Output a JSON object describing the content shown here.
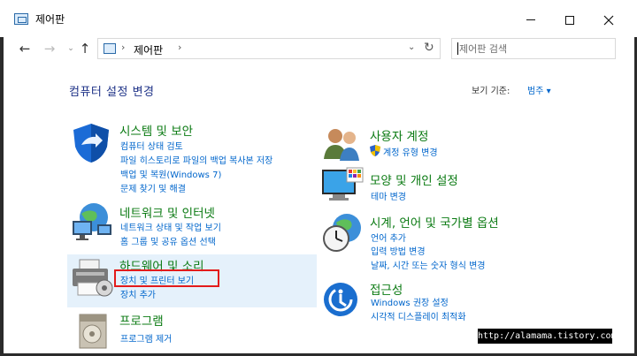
{
  "window": {
    "title": "제어판"
  },
  "nav": {
    "back": "←",
    "forward": "→",
    "recent": "⌄",
    "up": "↑",
    "address": "제어판",
    "refresh": "↻",
    "search_placeholder": "제어판 검색"
  },
  "main": {
    "heading": "컴퓨터 설정 변경",
    "viewby_label": "보기 기준:",
    "viewby_value": "범주 ▾"
  },
  "categories": [
    {
      "title": "시스템 및 보안",
      "icon": "shield-icon",
      "links": [
        "컴퓨터 상태 검토",
        "파일 히스토리로 파일의 백업 복사본 저장",
        "백업 및 복원(Windows 7)",
        "문제 찾기 및 해결"
      ]
    },
    {
      "title": "네트워크 및 인터넷",
      "icon": "network-icon",
      "links": [
        "네트워크 상태 및 작업 보기",
        "홈 그룹 및 공유 옵션 선택"
      ]
    },
    {
      "title": "하드웨어 및 소리",
      "icon": "printer-icon",
      "links": [
        "장치 및 프린터 보기",
        "장치 추가"
      ]
    },
    {
      "title": "프로그램",
      "icon": "programs-icon",
      "links": [
        "프로그램 제거"
      ]
    },
    {
      "title": "사용자 계정",
      "icon": "users-icon",
      "links": [
        "계정 유형 변경"
      ]
    },
    {
      "title": "모양 및 개인 설정",
      "icon": "monitor-icon",
      "links": [
        "테마 변경"
      ]
    },
    {
      "title": "시계, 언어 및 국가별 옵션",
      "icon": "clock-globe-icon",
      "links": [
        "언어 추가",
        "입력 방법 변경",
        "날짜, 시간 또는 숫자 형식 변경"
      ]
    },
    {
      "title": "접근성",
      "icon": "accessibility-icon",
      "links": [
        "Windows 권장 설정",
        "시각적 디스플레이 최적화"
      ]
    }
  ],
  "watermark": "http://alamama.tistory.com",
  "colors": {
    "category_green": "#0a7a12",
    "link_blue": "#0066cc",
    "heading_navy": "#1e3287",
    "highlight": "#e5f1fb",
    "red_outline": "#e31b1b"
  }
}
